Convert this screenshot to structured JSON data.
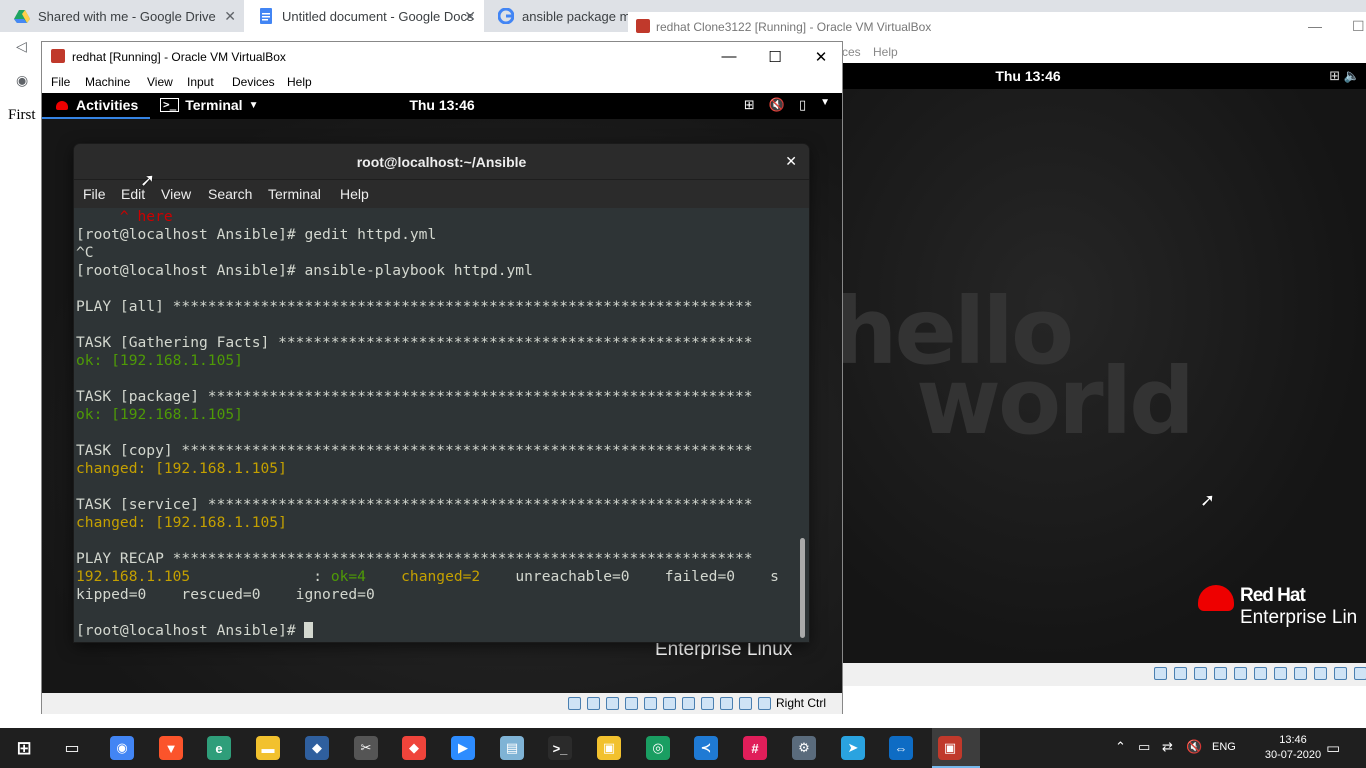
{
  "browser": {
    "tabs": [
      {
        "label": "Shared with me - Google Drive",
        "icon": "google-drive-icon"
      },
      {
        "label": "Untitled document - Google Docs",
        "icon": "google-docs-icon"
      },
      {
        "label": "ansible package mod",
        "icon": "google-icon"
      }
    ],
    "doc_text": "First"
  },
  "vm_background": {
    "title": "redhat Clone3122 [Running] - Oracle VM VirtualBox",
    "menu": [
      "ces",
      "Help"
    ],
    "clock": "Thu 13:46",
    "wallpaper_line1": "hello",
    "wallpaper_line2": "world",
    "brand": "Red Hat",
    "brand_sub": "Enterprise Lin"
  },
  "vm_main": {
    "title": "redhat [Running] - Oracle VM VirtualBox",
    "menu": [
      "File",
      "Machine",
      "View",
      "Input",
      "Devices",
      "Help"
    ],
    "host_key": "Right Ctrl"
  },
  "gnome": {
    "activities": "Activities",
    "app": "Terminal",
    "clock": "Thu 13:46",
    "wallpaper_text": "Enterprise Linux"
  },
  "terminal": {
    "title": "root@localhost:~/Ansible",
    "menu": [
      "File",
      "Edit",
      "View",
      "Search",
      "Terminal",
      "Help"
    ],
    "lines": [
      {
        "segments": [
          {
            "text": "     ^ here",
            "color": "red"
          }
        ]
      },
      {
        "segments": [
          {
            "text": "[root@localhost Ansible]# gedit httpd.yml",
            "color": "default"
          }
        ]
      },
      {
        "segments": [
          {
            "text": "^C",
            "color": "default"
          }
        ]
      },
      {
        "segments": [
          {
            "text": "[root@localhost Ansible]# ansible-playbook httpd.yml",
            "color": "default"
          }
        ]
      },
      {
        "segments": [
          {
            "text": "",
            "color": "default"
          }
        ]
      },
      {
        "segments": [
          {
            "text": "PLAY [all] ******************************************************************",
            "color": "default"
          }
        ]
      },
      {
        "segments": [
          {
            "text": "",
            "color": "default"
          }
        ]
      },
      {
        "segments": [
          {
            "text": "TASK [Gathering Facts] ******************************************************",
            "color": "default"
          }
        ]
      },
      {
        "segments": [
          {
            "text": "ok: [192.168.1.105]",
            "color": "green"
          }
        ]
      },
      {
        "segments": [
          {
            "text": "",
            "color": "default"
          }
        ]
      },
      {
        "segments": [
          {
            "text": "TASK [package] **************************************************************",
            "color": "default"
          }
        ]
      },
      {
        "segments": [
          {
            "text": "ok: [192.168.1.105]",
            "color": "green"
          }
        ]
      },
      {
        "segments": [
          {
            "text": "",
            "color": "default"
          }
        ]
      },
      {
        "segments": [
          {
            "text": "TASK [copy] *****************************************************************",
            "color": "default"
          }
        ]
      },
      {
        "segments": [
          {
            "text": "changed: [192.168.1.105]",
            "color": "yellow"
          }
        ]
      },
      {
        "segments": [
          {
            "text": "",
            "color": "default"
          }
        ]
      },
      {
        "segments": [
          {
            "text": "TASK [service] **************************************************************",
            "color": "default"
          }
        ]
      },
      {
        "segments": [
          {
            "text": "changed: [192.168.1.105]",
            "color": "yellow"
          }
        ]
      },
      {
        "segments": [
          {
            "text": "",
            "color": "default"
          }
        ]
      },
      {
        "segments": [
          {
            "text": "PLAY RECAP ******************************************************************",
            "color": "default"
          }
        ]
      },
      {
        "segments": [
          {
            "text": "192.168.1.105",
            "color": "yellow"
          },
          {
            "text": "              : ",
            "color": "default"
          },
          {
            "text": "ok=4",
            "color": "green"
          },
          {
            "text": "    ",
            "color": "default"
          },
          {
            "text": "changed=2",
            "color": "yellow"
          },
          {
            "text": "    unreachable=0    failed=0    s",
            "color": "default"
          }
        ]
      },
      {
        "segments": [
          {
            "text": "kipped=0    rescued=0    ignored=0",
            "color": "default"
          }
        ]
      },
      {
        "segments": [
          {
            "text": "",
            "color": "default"
          }
        ]
      },
      {
        "segments": [
          {
            "text": "[root@localhost Ansible]# ",
            "color": "default"
          }
        ],
        "cursor": true
      }
    ]
  },
  "taskbar": {
    "apps": [
      {
        "name": "chrome-icon",
        "color": "#4285f4",
        "glyph": "◉"
      },
      {
        "name": "brave-icon",
        "color": "#fb542b",
        "glyph": "▼"
      },
      {
        "name": "edge-icon",
        "color": "#2f9e7a",
        "glyph": "e"
      },
      {
        "name": "file-explorer-icon",
        "color": "#f2c12e",
        "glyph": "▬"
      },
      {
        "name": "virtualbox-icon",
        "color": "#2f5f9e",
        "glyph": "◆"
      },
      {
        "name": "snipping-icon",
        "color": "#555555",
        "glyph": "✂"
      },
      {
        "name": "anydesk-icon",
        "color": "#ef443b",
        "glyph": "◆"
      },
      {
        "name": "zoom-icon",
        "color": "#2d8cff",
        "glyph": "▶"
      },
      {
        "name": "notepad-icon",
        "color": "#7fb3d5",
        "glyph": "▤"
      },
      {
        "name": "cmd-icon",
        "color": "#2b2b2b",
        "glyph": ">_"
      },
      {
        "name": "file-manager-icon",
        "color": "#f2c12e",
        "glyph": "▣"
      },
      {
        "name": "gitkraken-icon",
        "color": "#1a9e62",
        "glyph": "◎"
      },
      {
        "name": "vscode-icon",
        "color": "#1f7ad4",
        "glyph": "≺"
      },
      {
        "name": "slack-icon",
        "color": "#e01e5a",
        "glyph": "#"
      },
      {
        "name": "network-icon",
        "color": "#5a6b7c",
        "glyph": "⚙"
      },
      {
        "name": "telegram-icon",
        "color": "#2aa3e0",
        "glyph": "➤"
      },
      {
        "name": "teamviewer-icon",
        "color": "#0e6cc4",
        "glyph": "⇔"
      },
      {
        "name": "virtualbox-vm-icon",
        "color": "#c0392b",
        "glyph": "▣"
      }
    ],
    "language": "ENG",
    "time": "13:46",
    "date": "30-07-2020"
  }
}
